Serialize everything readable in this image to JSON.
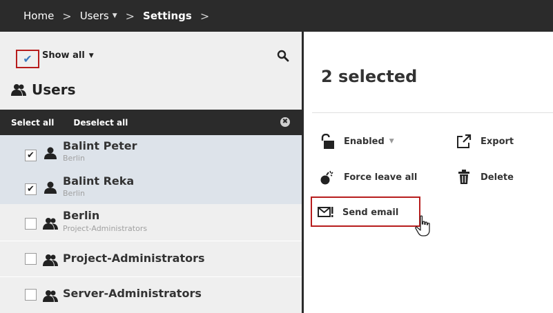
{
  "breadcrumb": {
    "home": "Home",
    "users": "Users",
    "settings": "Settings"
  },
  "filter": {
    "label": "Show all",
    "checked": true
  },
  "list": {
    "heading": "Users",
    "select_all": "Select all",
    "deselect_all": "Deselect all",
    "items": [
      {
        "title": "Balint Peter",
        "subtitle": "Berlin",
        "checked": true,
        "type": "user"
      },
      {
        "title": "Balint Reka",
        "subtitle": "Berlin",
        "checked": true,
        "type": "user"
      },
      {
        "title": "Berlin",
        "subtitle": "Project-Administrators",
        "checked": false,
        "type": "group"
      },
      {
        "title": "Project-Administrators",
        "subtitle": "",
        "checked": false,
        "type": "group"
      },
      {
        "title": "Server-Administrators",
        "subtitle": "",
        "checked": false,
        "type": "group"
      }
    ]
  },
  "panel": {
    "title": "2 selected",
    "actions": {
      "enabled": "Enabled",
      "export": "Export",
      "force_leave_all": "Force leave all",
      "delete": "Delete",
      "send_email": "Send email"
    }
  },
  "colors": {
    "topbar": "#2b2b2b",
    "highlight": "#b71c1c",
    "selected_row": "#dde3ea",
    "check_accent": "#3a7abf"
  },
  "icons": {
    "search": "search-icon",
    "users": "users-icon",
    "user": "user-icon",
    "lock": "unlock-icon",
    "export": "export-icon",
    "force_leave": "force-leave-icon",
    "delete": "trash-icon",
    "email": "email-icon",
    "cursor": "hand-cursor-icon"
  }
}
